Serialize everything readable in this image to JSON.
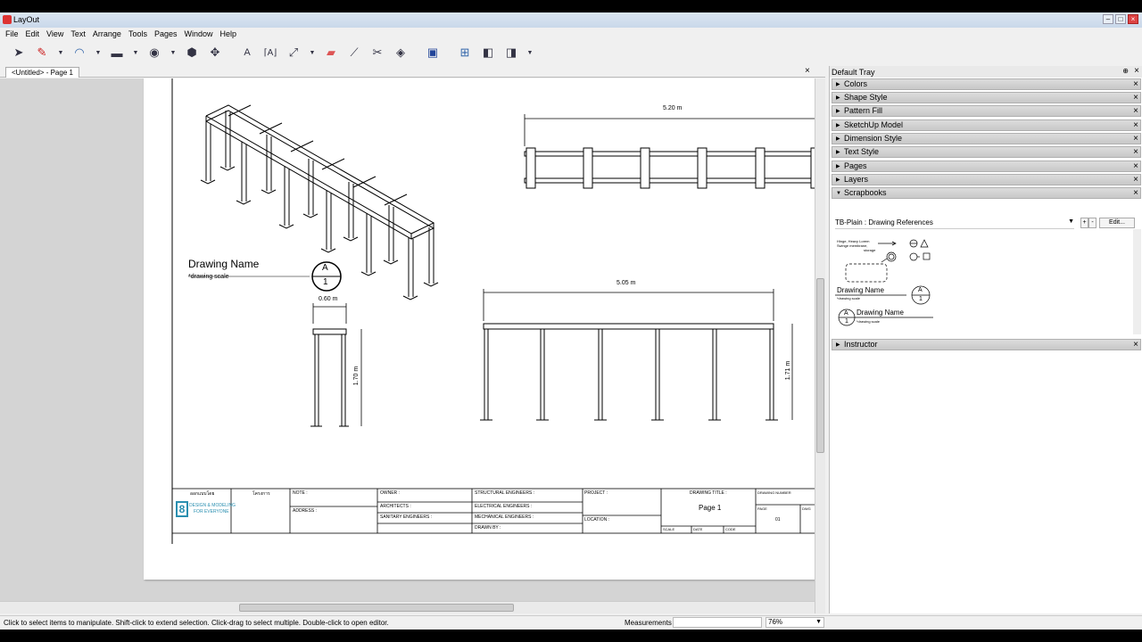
{
  "window": {
    "title": "LayOut",
    "btn_min": "–",
    "btn_max": "□",
    "btn_close": "×"
  },
  "menu": [
    "File",
    "Edit",
    "View",
    "Text",
    "Arrange",
    "Tools",
    "Pages",
    "Window",
    "Help"
  ],
  "toolbar": [
    "select-icon",
    "pencil-icon",
    "arc-icon",
    "rectangle-icon",
    "circle-icon",
    "polygon-icon",
    "explode-icon",
    "text-icon",
    "label-icon",
    "dimension-icon",
    "eraser-icon",
    "eyedropper-icon",
    "split-icon",
    "join-icon",
    "presentation-icon",
    "add-page-icon",
    "prev-page-icon",
    "next-page-icon"
  ],
  "document_tab": {
    "label": "<Untitled> - Page 1",
    "close": "×"
  },
  "drawing": {
    "dim_top": "5.20 m",
    "dim_mid": "5.05 m",
    "dim_small": "0.60 m",
    "dim_h_left": "1.70 m",
    "dim_h_right": "1.71 m",
    "drawing_name": "Drawing Name",
    "drawing_scale": "*drawing scale",
    "callout_letter": "A",
    "callout_number": "1"
  },
  "titleblock": {
    "c1": "ออกแบบโดย",
    "c2": "โครงการ",
    "note": "NOTE :",
    "address": "ADDRESS :",
    "owner": "OWNER :",
    "architects": "ARCHITECTS :",
    "sanitary": "SANITARY ENGINEERS :",
    "structural": "STRUCTURAL ENGINEERS :",
    "electrical": "ELECTRICAL ENGINEERS :",
    "mechanical": "MECHANICAL ENGINEERS :",
    "drawn_by": "DRAWN BY :",
    "project": "PROJECT :",
    "location": "LOCATION :",
    "drawing_title": "DRAWING TITLE :",
    "page_name": "Page 1",
    "scale": "SCALE",
    "date": "DATE",
    "code": "CODE",
    "drawing_number": "DRAWING NUMBER",
    "page": "PAGE",
    "page_num": "01",
    "dwg": "DWG",
    "logo_text": "DESIGN & MODELING",
    "logo_sub": "FOR EVERYONE",
    "logo_digit": "8"
  },
  "tray": {
    "title": "Default Tray",
    "pin": "⊕",
    "close": "×",
    "panels": [
      "Colors",
      "Shape Style",
      "Pattern Fill",
      "SketchUp Model",
      "Dimension Style",
      "Text Style",
      "Pages",
      "Layers",
      "Scrapbooks"
    ],
    "scrapbook": "TB-Plain : Drawing References",
    "edit_label": "Edit...",
    "sb_plus": "+",
    "sb_minus": "-",
    "sample_name": "Drawing Name",
    "sample_scale": "*drawing scale",
    "sample_name2": "Drawing Name",
    "sample_scale2": "*drawing scale",
    "note_text1": "Hinge, Heavy Lorem",
    "note_text2": "Swinge membrane,",
    "note_text3": "storage",
    "instructor": "Instructor"
  },
  "status": {
    "message": "Click to select items to manipulate. Shift-click to extend selection. Click-drag to select multiple. Double-click to open editor.",
    "measurements_label": "Measurements",
    "zoom": "76%"
  }
}
